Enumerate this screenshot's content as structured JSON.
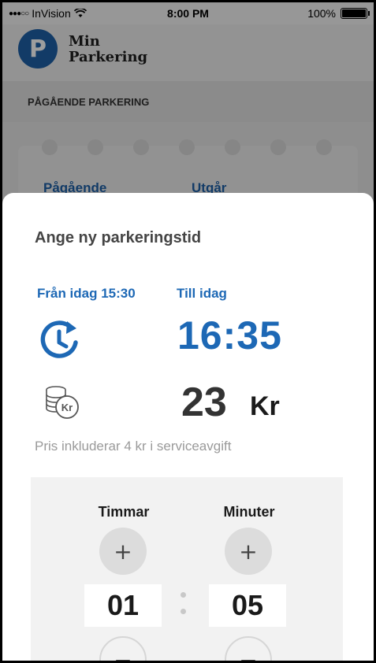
{
  "status_bar": {
    "carrier": "InVision",
    "time": "8:00 PM",
    "battery": "100%",
    "battery_level": 1.0
  },
  "header": {
    "logo_letter": "P",
    "brand_line1": "Min",
    "brand_line2": "Parkering"
  },
  "background": {
    "section_title": "PÅGÅENDE PARKERING",
    "ticket_labels": [
      "Pågående",
      "Utgår"
    ]
  },
  "sheet": {
    "title": "Ange ny parkeringstid",
    "from_label": "Från idag 15:30",
    "to_label": "Till idag",
    "end_time": "16:35",
    "price_amount": "23",
    "price_unit": "Kr",
    "coin_badge": "Kr",
    "price_note": "Pris inkluderar 4 kr i serviceavgift",
    "picker": {
      "hours_label": "Timmar",
      "minutes_label": "Minuter",
      "hours_value": "01",
      "minutes_value": "05",
      "plus_symbol": "+",
      "minus_symbol": "−"
    }
  },
  "colors": {
    "brand_blue": "#1d5fa6",
    "accent_blue": "#1d68b5"
  },
  "icons": {
    "clock": "clock-forward-icon",
    "coins": "coins-kr-icon",
    "wifi": "wifi-icon",
    "battery": "battery-icon"
  }
}
